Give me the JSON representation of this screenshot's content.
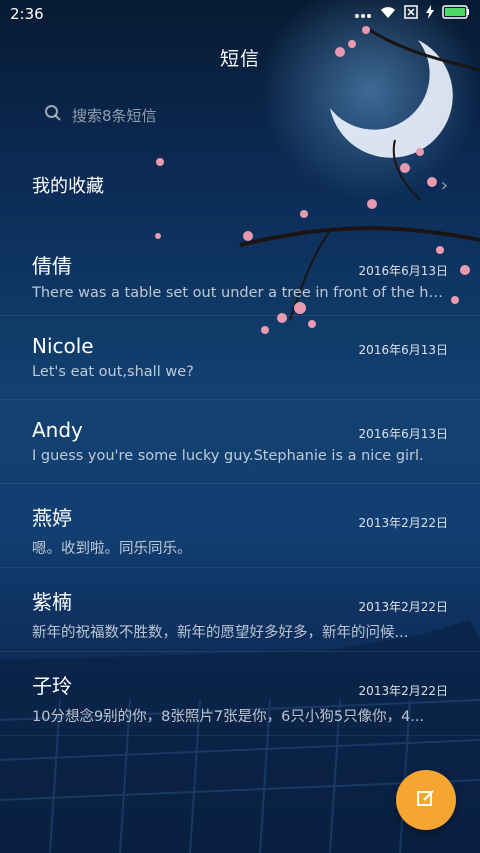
{
  "status_bar": {
    "time": "2:36"
  },
  "header": {
    "title": "短信"
  },
  "search": {
    "placeholder": "搜索8条短信"
  },
  "favorites": {
    "label": "我的收藏"
  },
  "messages": [
    {
      "name": "倩倩",
      "date": "2016年6月13日",
      "preview": "There was a table set out under a tree in front of the ho..."
    },
    {
      "name": "Nicole",
      "date": "2016年6月13日",
      "preview": "Let's eat out,shall we?"
    },
    {
      "name": "Andy",
      "date": "2016年6月13日",
      "preview": "I guess you're some lucky guy.Stephanie is a nice girl."
    },
    {
      "name": "燕婷",
      "date": "2013年2月22日",
      "preview": "嗯。收到啦。同乐同乐。"
    },
    {
      "name": "紫楠",
      "date": "2013年2月22日",
      "preview": "新年的祝福数不胜数，新年的愿望好多好多，新年的问候..."
    },
    {
      "name": "子玲",
      "date": "2013年2月22日",
      "preview": "10分想念9别的你，8张照片7张是你，6只小狗5只像你，4..."
    }
  ],
  "colors": {
    "accent": "#f7a531",
    "background": "#12406f"
  },
  "icons": {
    "search": "search-icon",
    "compose": "compose-icon",
    "wifi": "wifi-icon",
    "battery": "battery-icon"
  }
}
